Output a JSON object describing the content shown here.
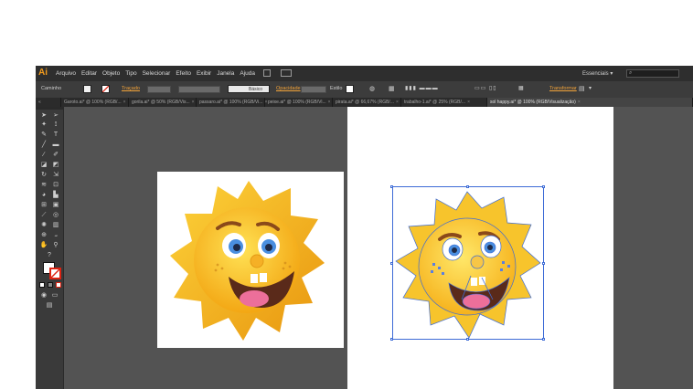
{
  "app": {
    "logo": "Ai"
  },
  "menu": [
    "Arquivo",
    "Editar",
    "Objeto",
    "Tipo",
    "Selecionar",
    "Efeito",
    "Exibir",
    "Janela",
    "Ajuda"
  ],
  "workspace": "Essenciais",
  "search_icon": "⌕",
  "control_bar": {
    "selection": "Caminho",
    "stroke_link": "Traçado",
    "brush": "Básico",
    "opacity_label": "Opacidade",
    "style_label": "Estilo",
    "transform_link": "Transformar"
  },
  "tabs": [
    {
      "label": "Garoto.ai* @ 100% (RGB/...",
      "close": "×"
    },
    {
      "label": "gorila.ai* @ 50% (RGB/Vis...",
      "close": "×"
    },
    {
      "label": "passaro.ai* @ 100% (RGB/Vi...",
      "close": "×"
    },
    {
      "label": "peixe.ai* @ 100% (RGB/Vi...",
      "close": "×"
    },
    {
      "label": "pirata.ai* @ 66,67% (RGB/...",
      "close": "×"
    },
    {
      "label": "trabalho-1.ai* @ 25% (RGB/...",
      "close": "×"
    },
    {
      "label": "sol happy.ai* @ 100% (RGB/Visualização)",
      "close": "×"
    }
  ],
  "tools": [
    "selection-icon",
    "direct-selection-icon",
    "magic-wand-icon",
    "lasso-icon",
    "pen-icon",
    "type-icon",
    "line-icon",
    "rectangle-icon",
    "brush-icon",
    "pencil-icon",
    "blob-brush-icon",
    "eraser-icon",
    "rotate-icon",
    "scale-icon",
    "warp-icon",
    "free-transform-icon",
    "shape-builder-icon",
    "perspective-icon",
    "mesh-icon",
    "gradient-icon",
    "eyedropper-icon",
    "blend-icon",
    "symbol-sprayer-icon",
    "graph-icon",
    "artboard-icon",
    "slice-icon",
    "hand-icon",
    "zoom-icon"
  ],
  "colors": {
    "accent": "#f29b1d",
    "sun_outer": "#f7b21a",
    "sun_face": "#fcc824",
    "eye": "#4a8fe0",
    "mouth": "#5a2a1a",
    "tongue": "#ec6f9a",
    "path_blue": "#3d6bd6"
  }
}
